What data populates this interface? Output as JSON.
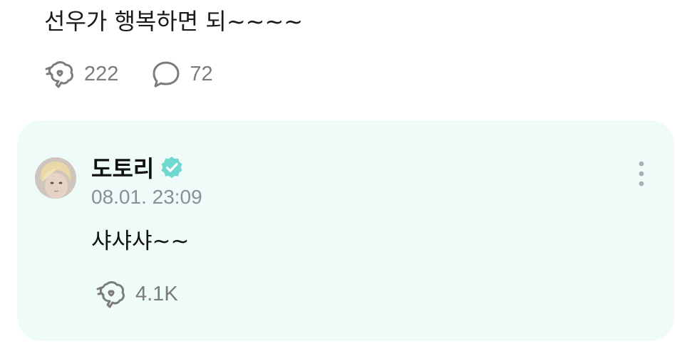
{
  "post": {
    "text": "선우가 행복하면 되~~~~",
    "reactions_count": "222",
    "comments_count": "72"
  },
  "reply": {
    "author": "도토리",
    "verified": true,
    "timestamp": "08.01. 23:09",
    "text": "샤샤샤~~",
    "reactions_count": "4.1K"
  },
  "icons": {
    "reaction": "reaction-icon",
    "comment": "comment-bubble-icon",
    "verified": "verified-badge-icon",
    "more": "more-vertical-icon"
  },
  "colors": {
    "card_background": "#eefbf8",
    "verified_badge": "#6fd8cf",
    "icon_gray": "#7b7b7b",
    "timestamp_gray": "#8a8f93"
  }
}
